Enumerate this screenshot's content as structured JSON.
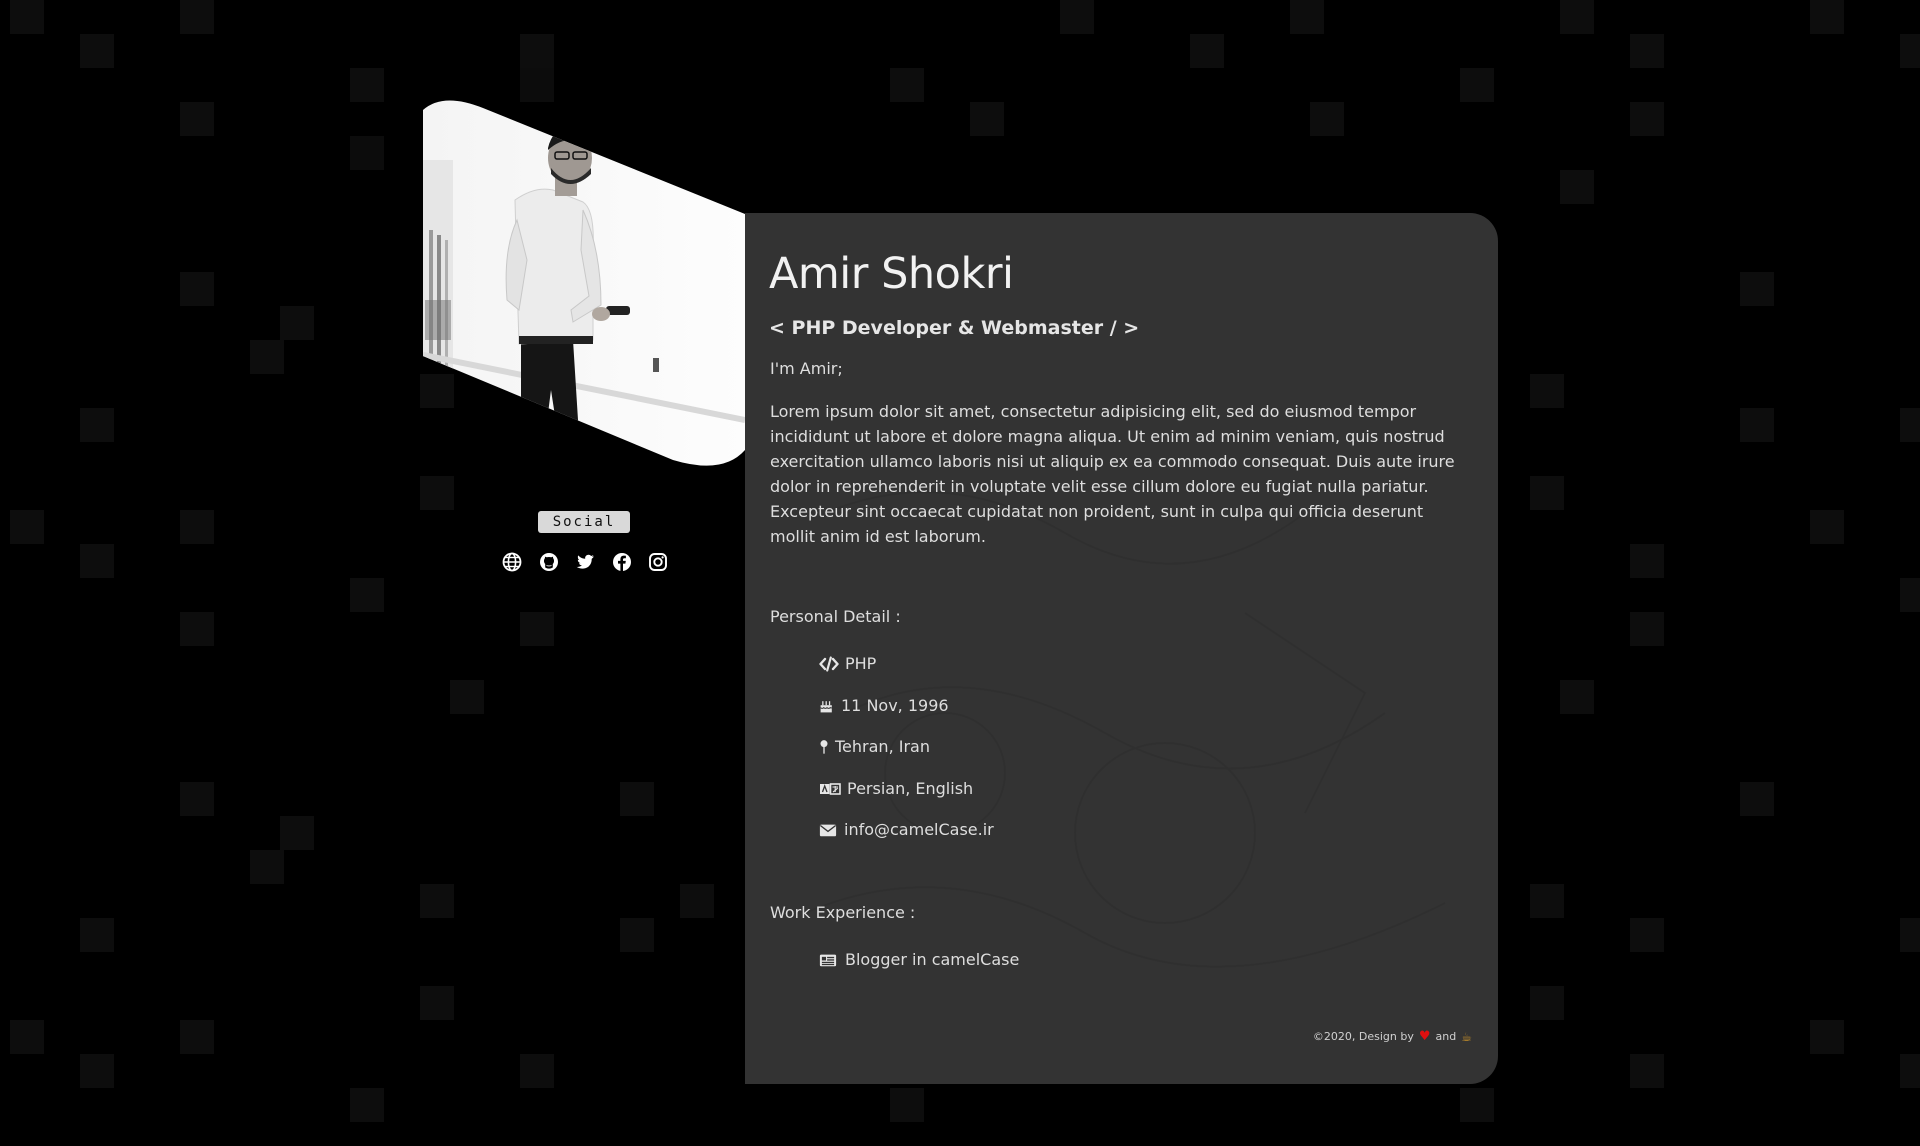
{
  "profile": {
    "name": "Amir Shokri",
    "role": "< PHP Developer & Webmaster / >",
    "greeting": "I'm Amir;",
    "bio": "Lorem ipsum dolor sit amet, consectetur adipisicing elit, sed do eiusmod tempor incididunt ut labore et dolore magna aliqua. Ut enim ad minim veniam, quis nostrud exercitation ullamco laboris nisi ut aliquip ex ea commodo consequat. Duis aute irure dolor in reprehenderit in voluptate velit esse cillum dolore eu fugiat nulla pariatur. Excepteur sint occaecat cupidatat non proident, sunt in culpa qui officia deserunt mollit anim id est laborum."
  },
  "social": {
    "label": "Social",
    "icons": [
      "globe-icon",
      "github-icon",
      "twitter-icon",
      "facebook-icon",
      "instagram-icon"
    ]
  },
  "personal": {
    "title": "Personal Detail :",
    "items": [
      {
        "icon": "code-icon",
        "text": "PHP"
      },
      {
        "icon": "birthday-cake-icon",
        "text": "11 Nov, 1996"
      },
      {
        "icon": "map-pin-icon",
        "text": "Tehran, Iran"
      },
      {
        "icon": "language-icon",
        "text": "Persian, English"
      },
      {
        "icon": "envelope-icon",
        "text": "info@camelCase.ir"
      }
    ]
  },
  "work": {
    "title": "Work Experience :",
    "items": [
      {
        "icon": "newspaper-icon",
        "text": "Blogger in camelCase"
      }
    ]
  },
  "footer": {
    "prefix": "©2020, Design by",
    "and": "and",
    "heart": "♥",
    "coffee": "☕"
  },
  "colors": {
    "background": "#000000",
    "card": "#333333",
    "heart": "#e01010",
    "coffee": "#c7902a",
    "badge": "#d9d9d9"
  }
}
